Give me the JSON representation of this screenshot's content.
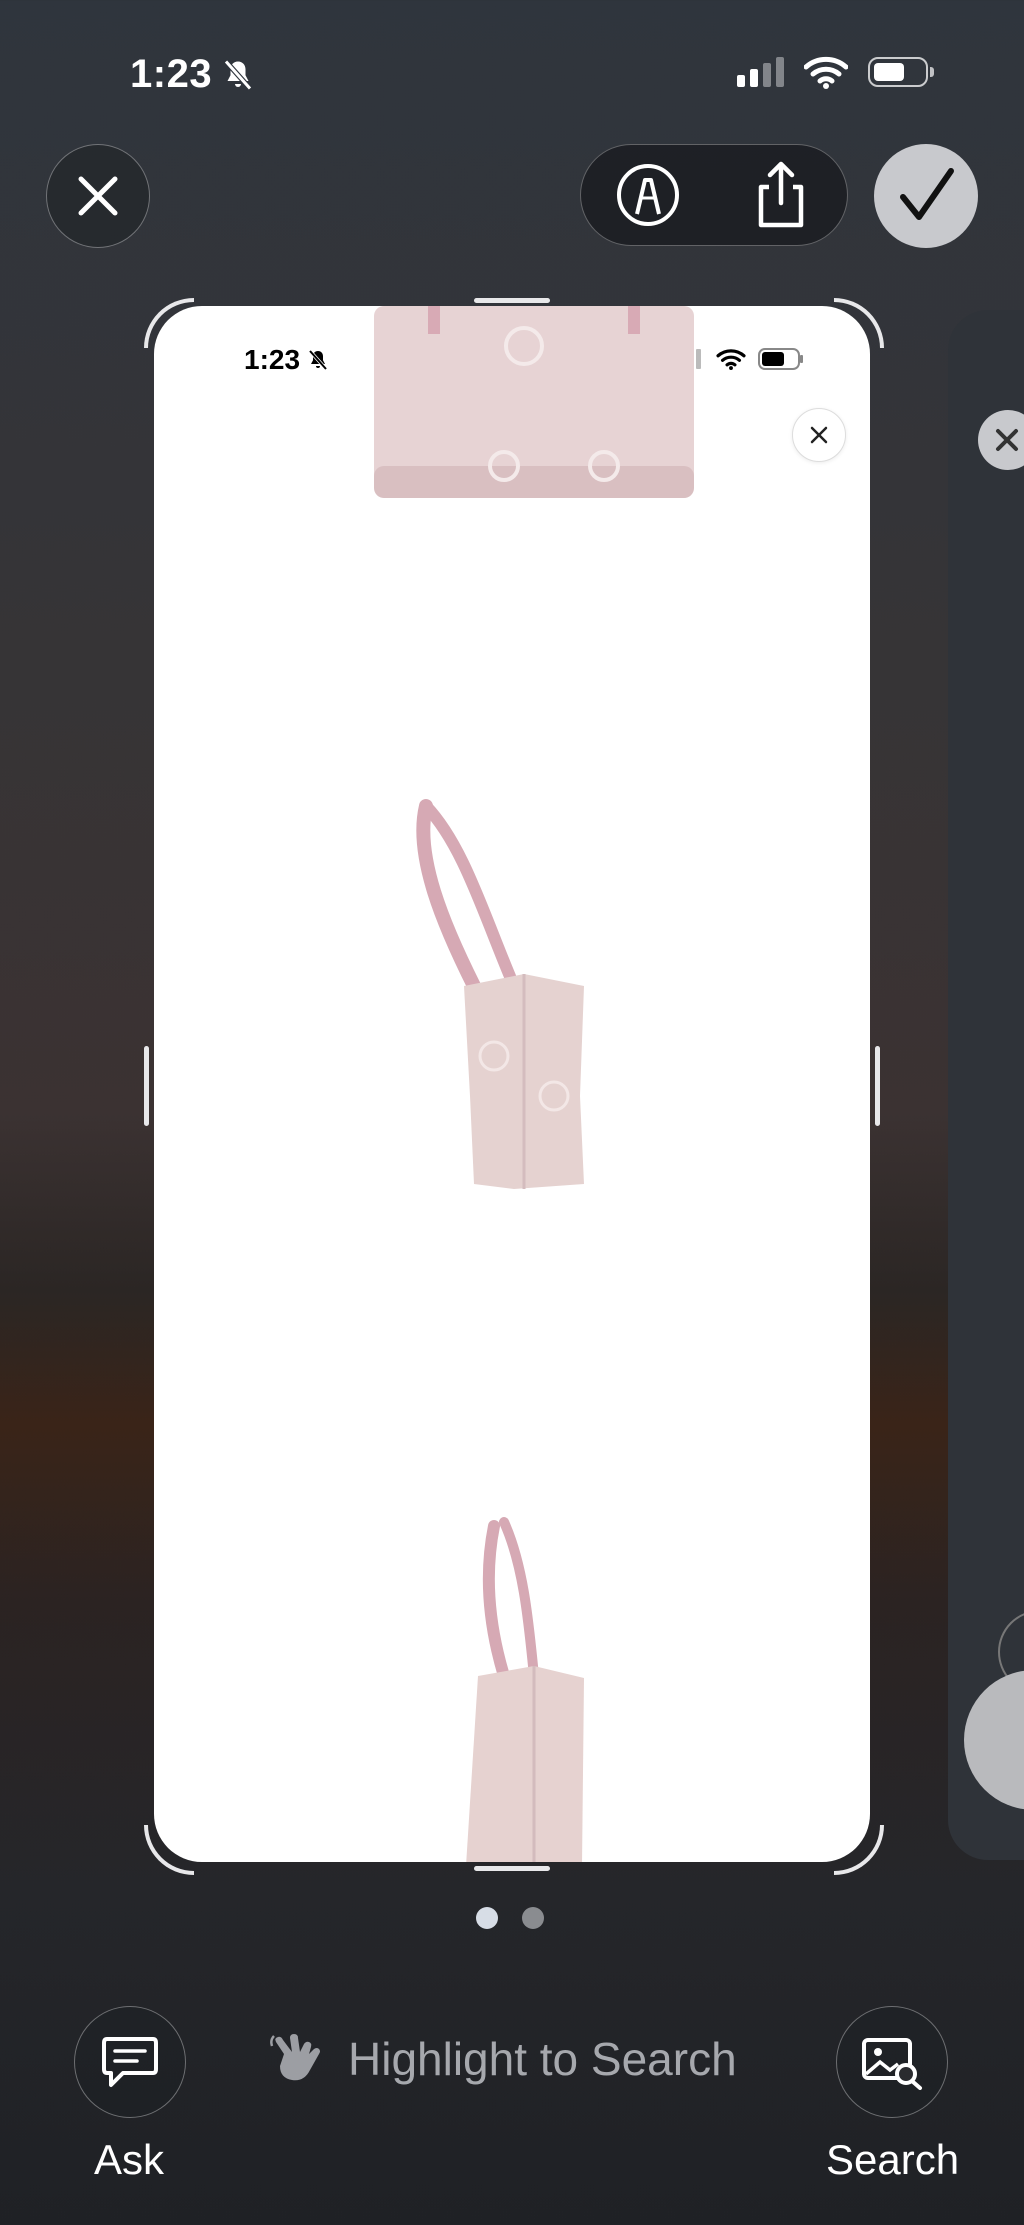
{
  "status_bar": {
    "time": "1:23",
    "silent_icon": "bell-slash-icon",
    "cellular_icon": "cellular-signal-icon",
    "wifi_icon": "wifi-icon",
    "battery_icon": "battery-icon"
  },
  "toolbar": {
    "close_icon": "close-icon",
    "markup_icon": "markup-pen-icon",
    "share_icon": "share-icon",
    "done_icon": "checkmark-icon"
  },
  "screenshot_preview": {
    "time": "1:23",
    "close_icon": "close-icon",
    "images": [
      "tote-bag-front",
      "tote-bag-side",
      "tote-bag-side-partial"
    ]
  },
  "page_indicator": {
    "count": 2,
    "current": 1
  },
  "bottom_bar": {
    "ask_label": "Ask",
    "ask_icon": "chat-bubble-icon",
    "highlight_text": "Highlight to Search",
    "highlight_icon": "hand-pointer-icon",
    "search_label": "Search",
    "search_icon": "image-search-icon"
  },
  "colors": {
    "accent_check_bg": "#c8c9cd",
    "bag_pink": "#e6cfd0",
    "dot_active": "#d7dde6",
    "dot_inactive": "#8a8c90"
  }
}
